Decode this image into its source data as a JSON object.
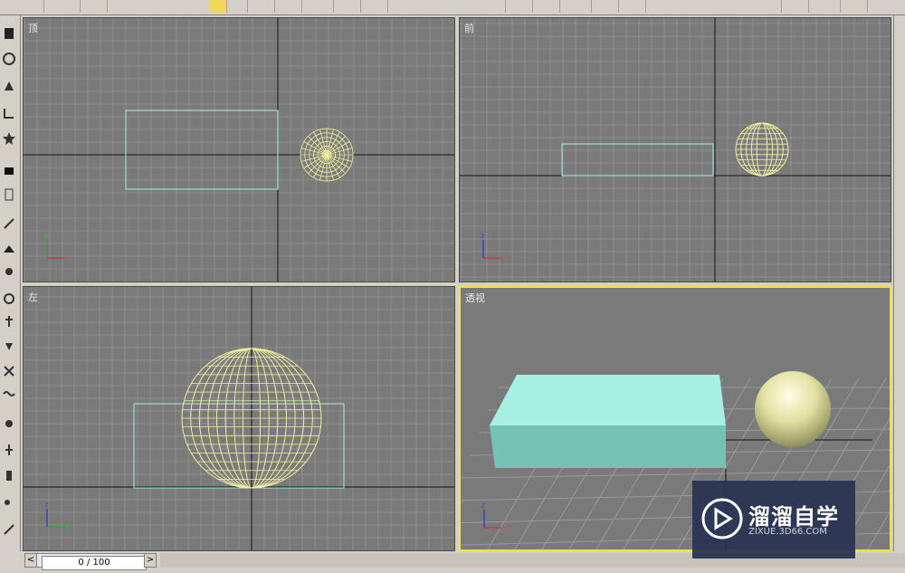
{
  "toolbar": {
    "buttons": [
      "select-object",
      "select-by-name",
      "select-region",
      "window-crossing",
      "select-move",
      "select-rotate",
      "select-scale",
      "mirror",
      "align",
      "named-selection"
    ]
  },
  "viewports": {
    "top": {
      "label": "顶"
    },
    "front": {
      "label": "前"
    },
    "left": {
      "label": "左"
    },
    "perspective": {
      "label": "透视"
    }
  },
  "axis_labels": {
    "x": "x",
    "y": "y",
    "z": "z"
  },
  "timeslider": {
    "frame": "0 / 100",
    "prev": "<",
    "next": ">"
  },
  "watermark": {
    "title": "溜溜自学",
    "subtitle": "ZIXUE.3D66.COM"
  },
  "colors": {
    "viewport_bg": "#7a7a7a",
    "grid": "#8f8f8f",
    "selection_box": "#a7f0e4",
    "sphere_wire": "#f3f0a0",
    "active_border": "#f2e24a",
    "box_top": "#a6efe2",
    "box_front": "#76c2b4",
    "sphere_shade": "#e8e6a6"
  }
}
